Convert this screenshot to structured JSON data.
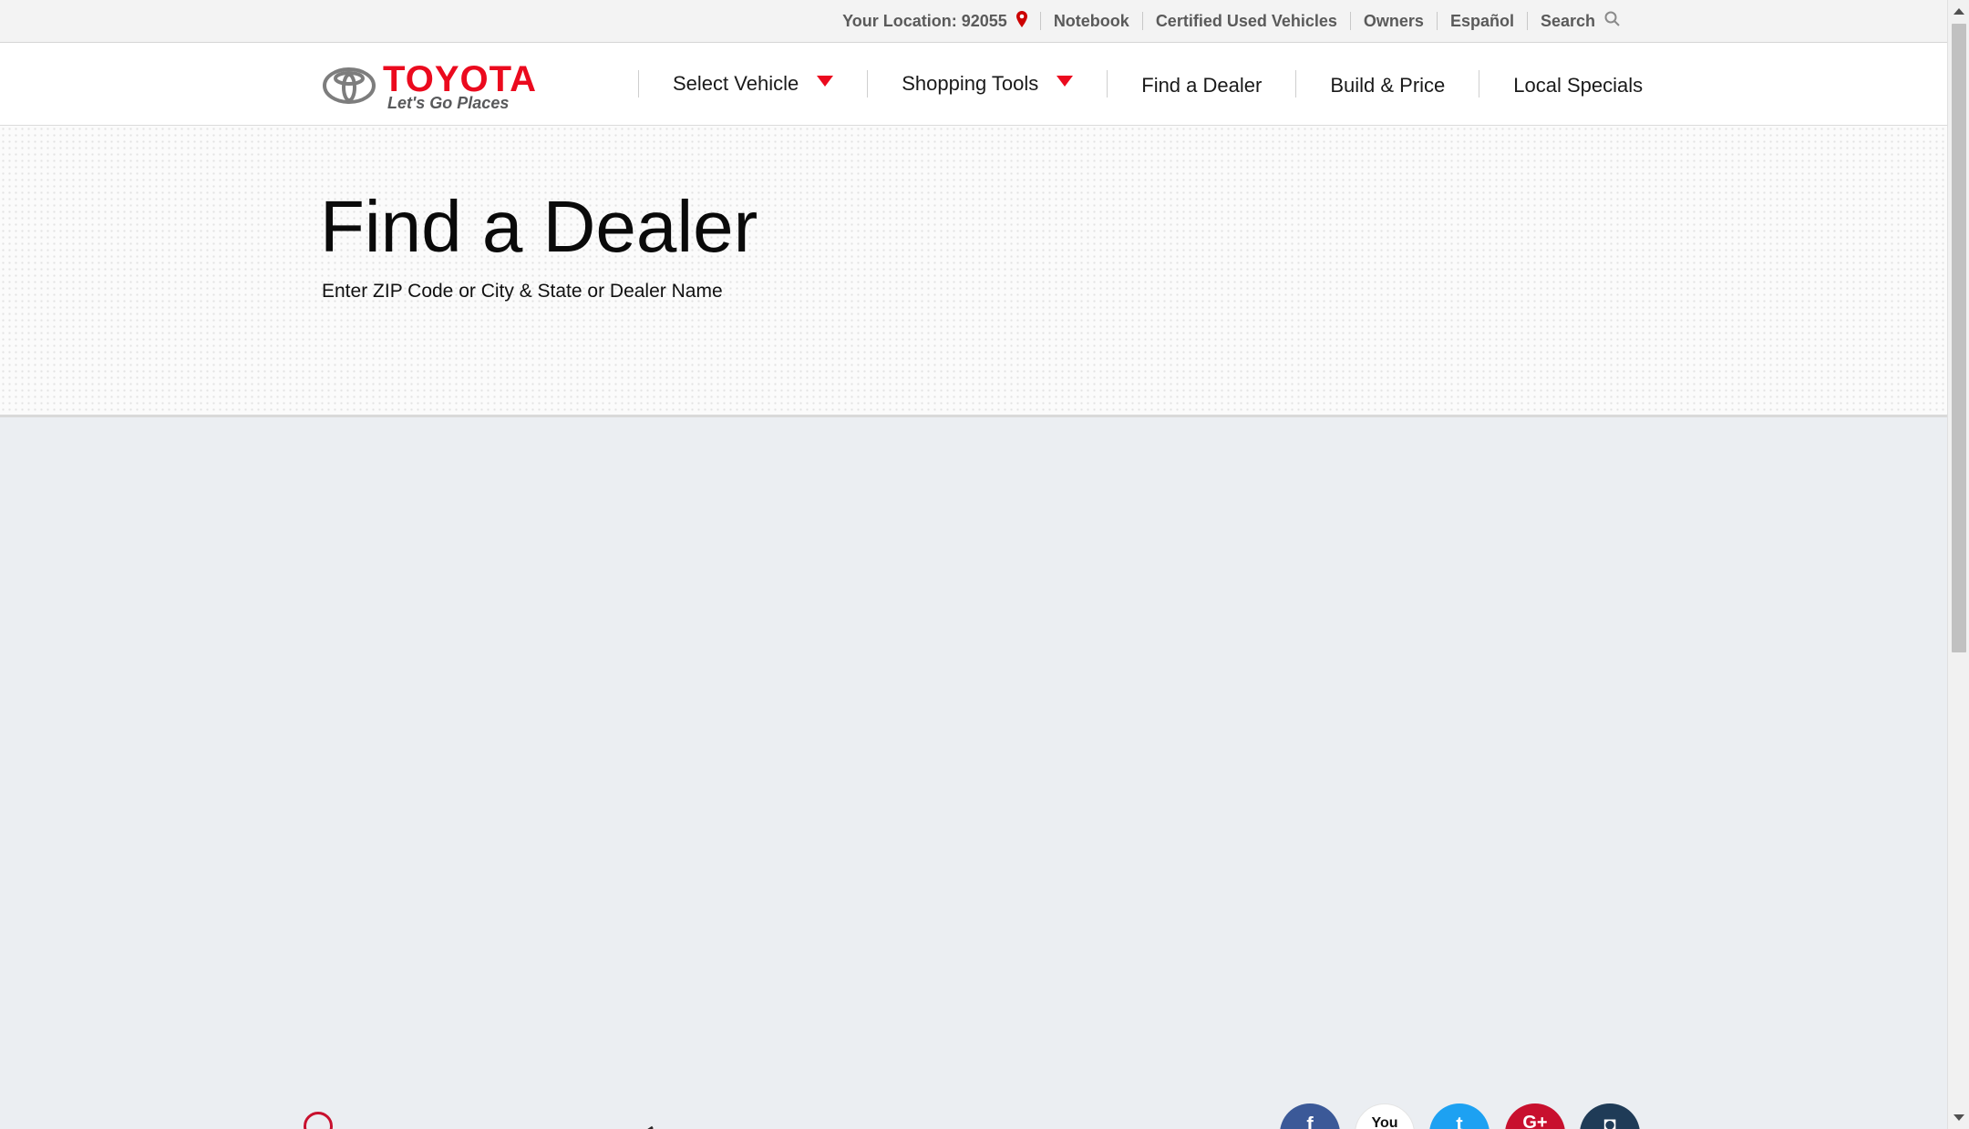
{
  "utility": {
    "location_label": "Your Location: 92055",
    "links": [
      "Notebook",
      "Certified Used Vehicles",
      "Owners",
      "Español"
    ],
    "search_label": "Search",
    "location_pin_color": "#cc0000"
  },
  "brand": {
    "wordmark": "TOYOTA",
    "tagline": "Let's Go Places",
    "color": "#eb0a1e"
  },
  "nav": {
    "items": [
      {
        "label": "Select Vehicle",
        "has_dropdown": true
      },
      {
        "label": "Shopping Tools",
        "has_dropdown": true
      },
      {
        "label": "Find a Dealer",
        "has_dropdown": false
      },
      {
        "label": "Build & Price",
        "has_dropdown": false
      },
      {
        "label": "Local Specials",
        "has_dropdown": false
      }
    ]
  },
  "hero": {
    "title": "Find a Dealer",
    "subtitle": "Enter ZIP Code or City & State or Dealer Name"
  },
  "footer": {
    "social": [
      {
        "name": "facebook",
        "glyph": "f",
        "color": "#3b5998"
      },
      {
        "name": "youtube",
        "glyph": "You",
        "color": "#ffffff"
      },
      {
        "name": "twitter",
        "glyph": "t",
        "color": "#1da1f2"
      },
      {
        "name": "google-plus",
        "glyph": "G+",
        "color": "#c8102e"
      },
      {
        "name": "instagram",
        "glyph": "◘",
        "color": "#1f3b57"
      }
    ]
  }
}
